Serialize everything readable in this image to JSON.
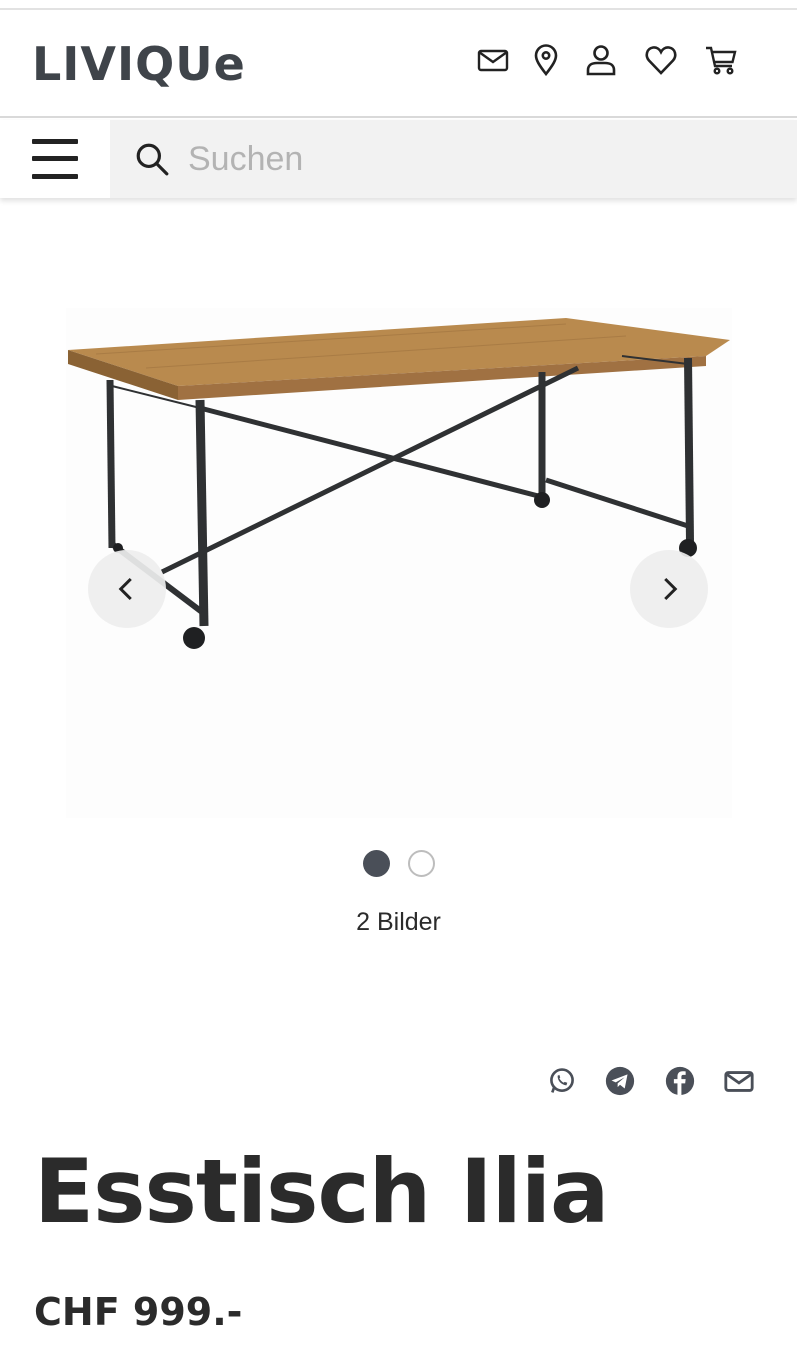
{
  "header": {
    "logo": "LIVIQUe",
    "icons": [
      "mail-icon",
      "location-pin-icon",
      "user-icon",
      "heart-icon",
      "cart-icon"
    ]
  },
  "search": {
    "placeholder": "Suchen"
  },
  "gallery": {
    "image_count_label": "2 Bilder",
    "active_index": 1,
    "total": 2
  },
  "share": {
    "icons": [
      "whatsapp-icon",
      "telegram-icon",
      "facebook-icon",
      "email-icon"
    ]
  },
  "product": {
    "title": "Esstisch Ilia",
    "price": "CHF 999.-"
  },
  "colors": {
    "text": "#2b2b2b",
    "logo": "#3f444a",
    "search_bg": "#f2f2f2",
    "dot_active": "#4a4f58"
  }
}
